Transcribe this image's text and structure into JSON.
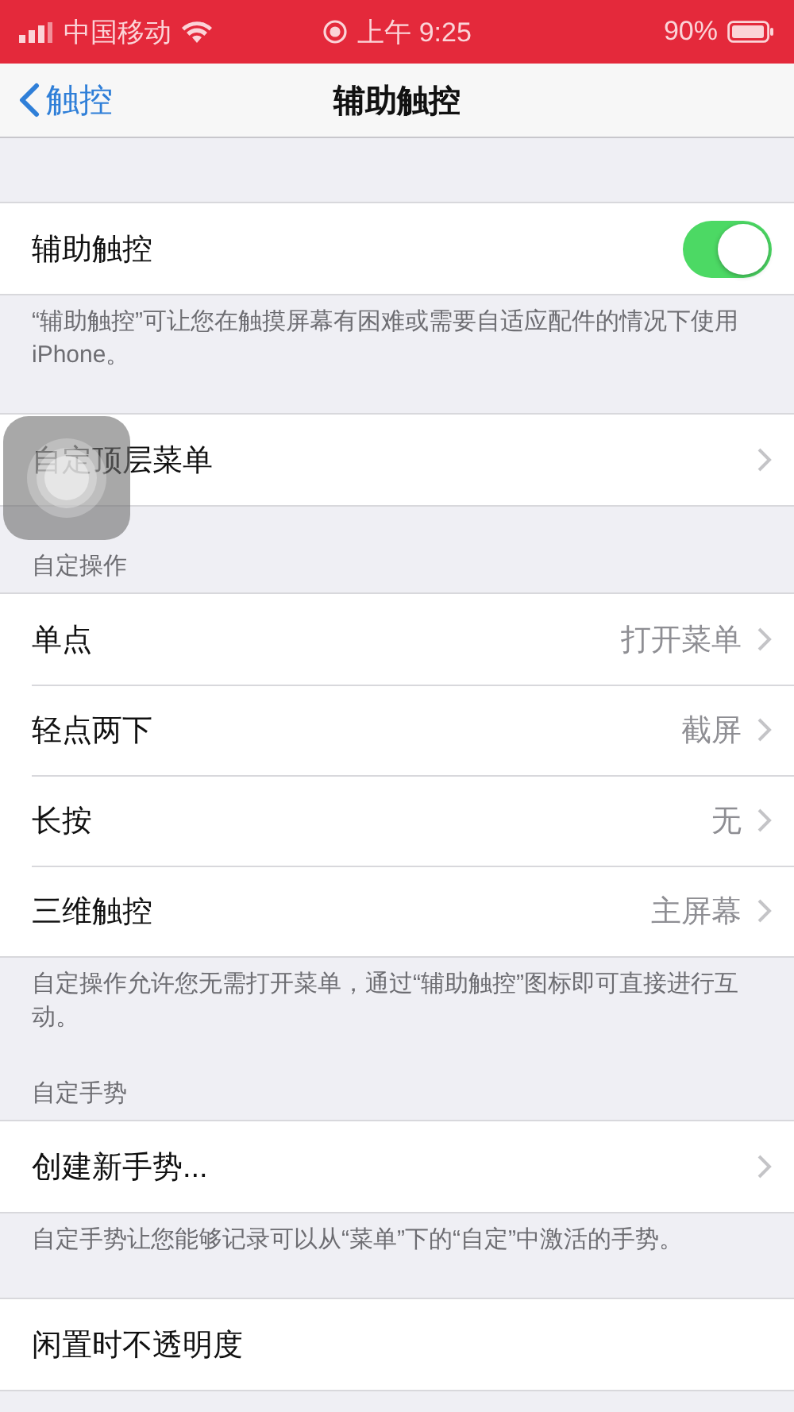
{
  "status_bar": {
    "carrier": "中国移动",
    "time": "上午 9:25",
    "battery": "90%"
  },
  "nav": {
    "back": "触控",
    "title": "辅助触控"
  },
  "sections": [
    {
      "rows": [
        {
          "kind": "toggle",
          "label": "辅助触控",
          "on": true
        }
      ],
      "footer": "“辅助触控”可让您在触摸屏幕有困难或需要自适应配件的情况下使用 iPhone。"
    },
    {
      "rows": [
        {
          "kind": "link",
          "label": "自定顶层菜单"
        }
      ]
    },
    {
      "header": "自定操作",
      "rows": [
        {
          "kind": "link",
          "label": "单点",
          "value": "打开菜单"
        },
        {
          "kind": "link",
          "label": "轻点两下",
          "value": "截屏"
        },
        {
          "kind": "link",
          "label": "长按",
          "value": "无"
        },
        {
          "kind": "link",
          "label": "三维触控",
          "value": "主屏幕"
        }
      ],
      "footer": "自定操作允许您无需打开菜单，通过“辅助触控”图标即可直接进行互动。"
    },
    {
      "header": "自定手势",
      "rows": [
        {
          "kind": "link",
          "label": "创建新手势..."
        }
      ],
      "footer": "自定手势让您能够记录可以从“菜单”下的“自定”中激活的手势。"
    },
    {
      "rows": [
        {
          "kind": "plain",
          "label": "闲置时不透明度"
        }
      ]
    }
  ]
}
